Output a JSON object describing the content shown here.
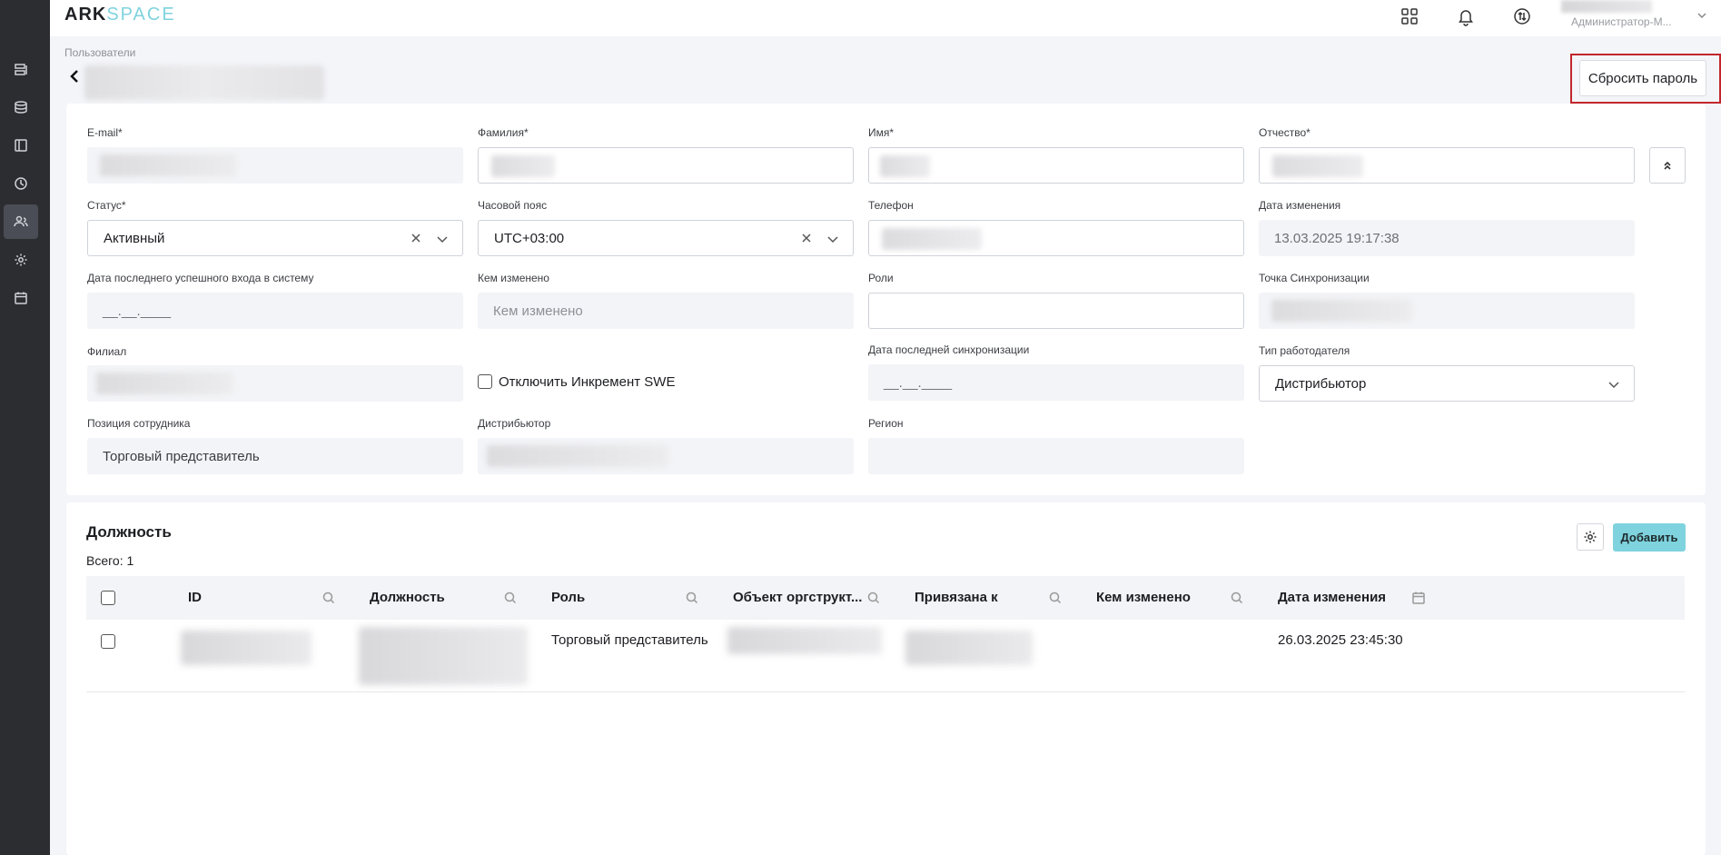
{
  "app": {
    "brand_prefix": "ARK",
    "brand_suffix": "SPACE",
    "user_role": "Администратор-М..."
  },
  "sidebar": {
    "items": [
      {
        "icon": "list-icon"
      },
      {
        "icon": "database-icon"
      },
      {
        "icon": "panel-icon"
      },
      {
        "icon": "clock-icon"
      },
      {
        "icon": "users-icon",
        "active": true
      },
      {
        "icon": "gear-icon"
      },
      {
        "icon": "calendar-icon"
      }
    ]
  },
  "header": {
    "breadcrumb": "Пользователи",
    "reset_password_label": "Сбросить пароль"
  },
  "form": {
    "email_label": "E-mail*",
    "last_name_label": "Фамилия*",
    "first_name_label": "Имя*",
    "middle_name_label": "Отчество*",
    "status_label": "Статус*",
    "status_value": "Активный",
    "timezone_label": "Часовой пояс",
    "timezone_value": "UTC+03:00",
    "phone_label": "Телефон",
    "modified_date_label": "Дата изменения",
    "modified_date_value": "13.03.2025 19:17:38",
    "last_login_label": "Дата последнего успешного входа в систему",
    "last_login_value": "__.__.____",
    "modified_by_label": "Кем изменено",
    "modified_by_placeholder": "Кем изменено",
    "roles_label": "Роли",
    "sync_point_label": "Точка Синхронизации",
    "branch_label": "Филиал",
    "disable_increment_label": "Отключить Инкремент SWE",
    "last_sync_label": "Дата последней синхронизации",
    "last_sync_value": "__.__.____",
    "employer_type_label": "Тип работодателя",
    "employer_type_value": "Дистрибьютор",
    "position_label": "Позиция сотрудника",
    "position_value": "Торговый представитель",
    "distributor_label": "Дистрибьютор",
    "region_label": "Регион"
  },
  "positions": {
    "title": "Должность",
    "total": "Всего: 1",
    "add_label": "Добавить",
    "columns": [
      "ID",
      "Должность",
      "Роль",
      "Объект оргструкт...",
      "Привязана к",
      "Кем изменено",
      "Дата изменения"
    ],
    "rows": [
      {
        "role": "Торговый представитель",
        "modified_date": "26.03.2025 23:45:30"
      }
    ]
  }
}
